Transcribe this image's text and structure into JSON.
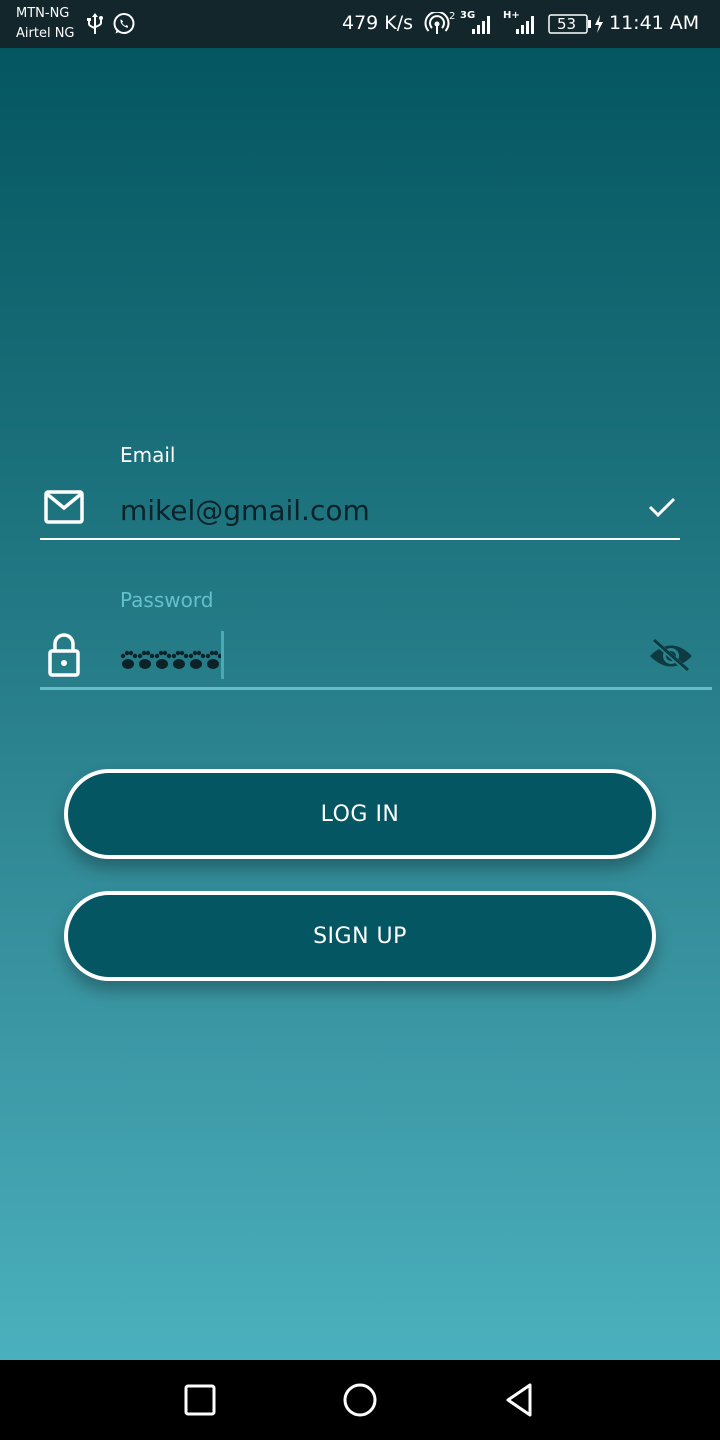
{
  "status_bar": {
    "carrier_1": "MTN-NG",
    "carrier_2": "Airtel NG",
    "speed": "479 K/s",
    "hotspot_superscript": "2",
    "network_3g": "3G",
    "network_hplus": "H+",
    "battery": "53",
    "time": "11:41 AM",
    "icons": [
      "usb-icon",
      "whatsapp-icon",
      "hotspot-icon",
      "signal-icon",
      "battery-icon",
      "charging-icon"
    ]
  },
  "login_form": {
    "email_label": "Email",
    "email_value": "mikel@gmail.com",
    "password_label": "Password",
    "password_mask_count": 6,
    "icons": [
      "mail-icon",
      "check-icon",
      "lock-icon",
      "eye-off-icon"
    ]
  },
  "buttons": {
    "login": "LOG IN",
    "signup": "SIGN UP"
  },
  "nav_bar": {
    "icons": [
      "recents-square-icon",
      "home-circle-icon",
      "back-triangle-icon"
    ]
  },
  "colors": {
    "status_bar_bg": "#12262c",
    "gradient_top": "#045761",
    "gradient_bottom": "#4bb0bd",
    "button_bg": "#045762",
    "button_border": "#ffffff",
    "password_accent": "#62bfca",
    "nav_bar_bg": "#000000"
  }
}
